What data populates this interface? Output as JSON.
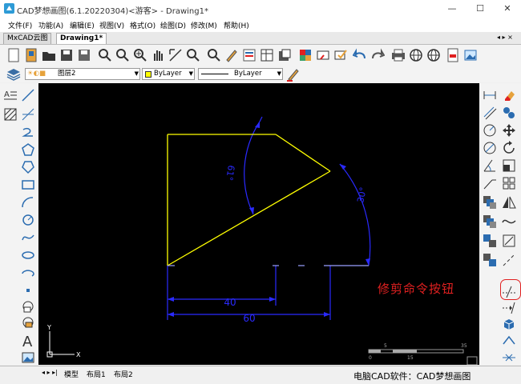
{
  "window": {
    "title": "CAD梦想画图(6.1.20220304)<游客> - Drawing1*",
    "minimize": "—",
    "maximize": "☐",
    "close": "✕"
  },
  "menu": {
    "items": [
      "文件(F)",
      "功能(A)",
      "编辑(E)",
      "视图(V)",
      "格式(O)",
      "绘图(D)",
      "修改(M)",
      "帮助(H)"
    ]
  },
  "tabs": {
    "items": [
      "MxCAD云图",
      "Drawing1*"
    ],
    "controls": "◂ ▸ ×"
  },
  "layer": {
    "layer_name": "图层2",
    "color_value": "ByLayer",
    "linetype_value": "ByLayer"
  },
  "drawing": {
    "dim_angle_a": "61°",
    "dim_angle_b": "30°",
    "dim_len_1": "40",
    "dim_len_2": "60",
    "ucs_x": "X",
    "ucs_y": "Y",
    "scale_labels": [
      "0",
      "5",
      "15",
      "35"
    ]
  },
  "layout_tabs": {
    "nav": "◂ ▸ ▸|",
    "items": [
      "模型",
      "布局1",
      "布局2"
    ]
  },
  "annotation": {
    "label": "修剪命令按钮"
  },
  "footer": {
    "watermark": "电脑CAD软件：CAD梦想画图"
  },
  "colors": {
    "canvas_bg": "#000000",
    "shape_stroke": "#ffff00",
    "dimension": "#2a2aff",
    "annotation": "#e02020"
  }
}
